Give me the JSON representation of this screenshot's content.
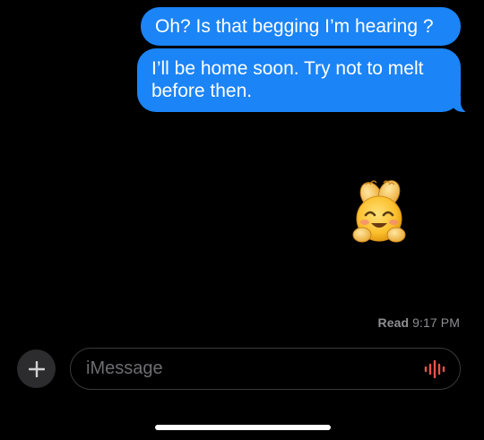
{
  "messages": [
    {
      "text": "Oh? Is that begging I’m hearing ?"
    },
    {
      "text": "I’ll be home soon. Try not to melt before then."
    }
  ],
  "sticker": {
    "icon": "blushing-smile-hands-emoji-icon"
  },
  "receipt": {
    "label": "Read",
    "time": "9:17 PM"
  },
  "composer": {
    "placeholder": "iMessage",
    "value": ""
  },
  "colors": {
    "bubble": "#1B84F7",
    "background": "#000000",
    "receipt": "#8E8E93",
    "mic": "#E8534A",
    "input_border": "#3A3A3C"
  }
}
